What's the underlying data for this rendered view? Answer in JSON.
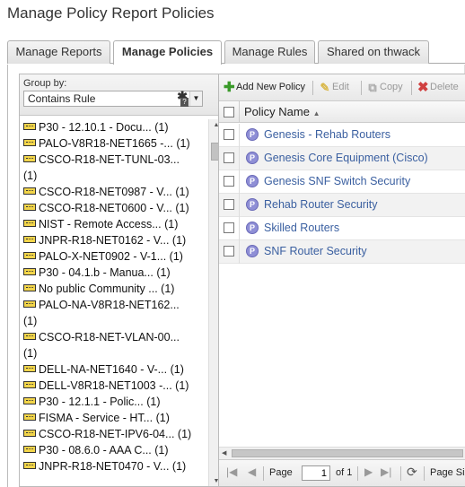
{
  "page": {
    "title": "Manage Policy Report Policies"
  },
  "tabs": [
    {
      "label": "Manage Reports",
      "active": false
    },
    {
      "label": "Manage Policies",
      "active": true
    },
    {
      "label": "Manage Rules",
      "active": false
    },
    {
      "label": "Shared on thwack",
      "active": false
    }
  ],
  "group_panel": {
    "label": "Group by:",
    "selected": "Contains Rule",
    "items": [
      {
        "name": "P30 - 12.10.1 - Docu...",
        "count": "(1)",
        "wrap": false
      },
      {
        "name": "PALO-V8R18-NET1665 -...",
        "count": "(1)",
        "wrap": false
      },
      {
        "name": "CSCO-R18-NET-TUNL-03...",
        "count": "(1)",
        "wrap": true
      },
      {
        "name": "CSCO-R18-NET0987 - V...",
        "count": "(1)",
        "wrap": false
      },
      {
        "name": "CSCO-R18-NET0600 - V...",
        "count": "(1)",
        "wrap": false
      },
      {
        "name": "NIST - Remote Access...",
        "count": "(1)",
        "wrap": false
      },
      {
        "name": "JNPR-R18-NET0162 - V...",
        "count": "(1)",
        "wrap": false
      },
      {
        "name": "PALO-X-NET0902 - V-1...",
        "count": "(1)",
        "wrap": false
      },
      {
        "name": "P30 - 04.1.b - Manua...",
        "count": "(1)",
        "wrap": false
      },
      {
        "name": "No public Community ...",
        "count": "(1)",
        "wrap": false
      },
      {
        "name": "PALO-NA-V8R18-NET162...",
        "count": "(1)",
        "wrap": true
      },
      {
        "name": "CSCO-R18-NET-VLAN-00...",
        "count": "(1)",
        "wrap": true
      },
      {
        "name": "DELL-NA-NET1640 - V-...",
        "count": "(1)",
        "wrap": false
      },
      {
        "name": "DELL-V8R18-NET1003 -...",
        "count": "(1)",
        "wrap": false
      },
      {
        "name": "P30 - 12.1.1 - Polic...",
        "count": "(1)",
        "wrap": false
      },
      {
        "name": "FISMA - Service - HT...",
        "count": "(1)",
        "wrap": false
      },
      {
        "name": "CSCO-R18-NET-IPV6-04...",
        "count": "(1)",
        "wrap": false
      },
      {
        "name": "P30 - 08.6.0 - AAA C...",
        "count": "(1)",
        "wrap": false
      },
      {
        "name": "JNPR-R18-NET0470 - V...",
        "count": "(1)",
        "wrap": false
      }
    ]
  },
  "toolbar": {
    "add_label": "Add New Policy",
    "edit_label": "Edit",
    "copy_label": "Copy",
    "delete_label": "Delete"
  },
  "grid": {
    "column_header": "Policy Name",
    "sort_indicator": "▲",
    "rows": [
      "Genesis - Rehab Routers",
      "Genesis Core Equipment (Cisco)",
      "Genesis SNF Switch Security",
      "Rehab Router Security",
      "Skilled Routers",
      "SNF Router Security"
    ]
  },
  "pager": {
    "page_label": "Page",
    "page_value": "1",
    "of_label": "of 1",
    "page_size_label": "Page Siz"
  },
  "colors": {
    "link": "#3a5fa0",
    "policy_icon": "#8f8fd6",
    "group_icon": "#f2d54a",
    "add_icon": "#3a9a2a",
    "delete_icon": "#d04040"
  }
}
